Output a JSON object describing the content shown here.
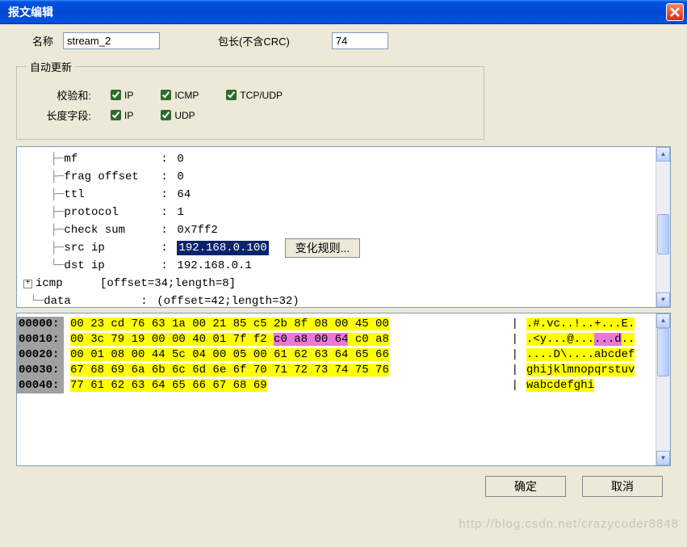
{
  "title": "报文编辑",
  "labels": {
    "name": "名称",
    "packetLen": "包长(不含CRC)",
    "autoUpdate": "自动更新",
    "checksum": "校验和:",
    "lengthField": "长度字段:",
    "ip": "IP",
    "icmp": "ICMP",
    "tcpudp": "TCP/UDP",
    "udp": "UDP",
    "changeRule": "变化规则...",
    "ok": "确定",
    "cancel": "取消"
  },
  "fields": {
    "name": "stream_2",
    "packetLen": "74"
  },
  "checkboxes": {
    "cs_ip": true,
    "cs_icmp": true,
    "cs_tcpudp": true,
    "len_ip": true,
    "len_udp": true
  },
  "tree": [
    {
      "conn": "    ├─",
      "name": "mf",
      "val": "0"
    },
    {
      "conn": "    ├─",
      "name": "frag offset",
      "val": "0"
    },
    {
      "conn": "    ├─",
      "name": "ttl",
      "val": "64"
    },
    {
      "conn": "    ├─",
      "name": "protocol",
      "val": "1"
    },
    {
      "conn": "    ├─",
      "name": "check sum",
      "val": "0x7ff2"
    },
    {
      "conn": "    ├─",
      "name": "src ip",
      "val": "192.168.0.100",
      "sel": true
    },
    {
      "conn": "    └─",
      "name": "dst ip",
      "val": "192.168.0.1"
    },
    {
      "plus": true,
      "name": "icmp",
      "val": "[offset=34;length=8]"
    },
    {
      "conn": " └─",
      "name": "data",
      "val": "(offset=42;length=32)"
    }
  ],
  "hex": [
    {
      "off": "00000:",
      "b": "00 23 cd 76 63 1a 00 21 85 c5 2b 8f 08 00 45 00",
      "a": ".#.vc..!..+...E."
    },
    {
      "off": "00010:",
      "pre": "00 3c 79 19 00 00 40 01 7f f2 ",
      "hi": "c0 a8 00 64",
      "post": " c0 a8",
      "a_pre": ".<y...@...",
      "a_hi": "...d",
      "a_post": ".."
    },
    {
      "off": "00020:",
      "b": "00 01 08 00 44 5c 04 00 05 00 61 62 63 64 65 66",
      "a": "....D\\....abcdef"
    },
    {
      "off": "00030:",
      "b": "67 68 69 6a 6b 6c 6d 6e 6f 70 71 72 73 74 75 76",
      "a": "ghijklmnopqrstuv"
    },
    {
      "off": "00040:",
      "b": "77 61 62 63 64 65 66 67 68 69",
      "a": "wabcdefghi"
    }
  ],
  "watermark": "http://blog.csdn.net/crazycoder8848"
}
